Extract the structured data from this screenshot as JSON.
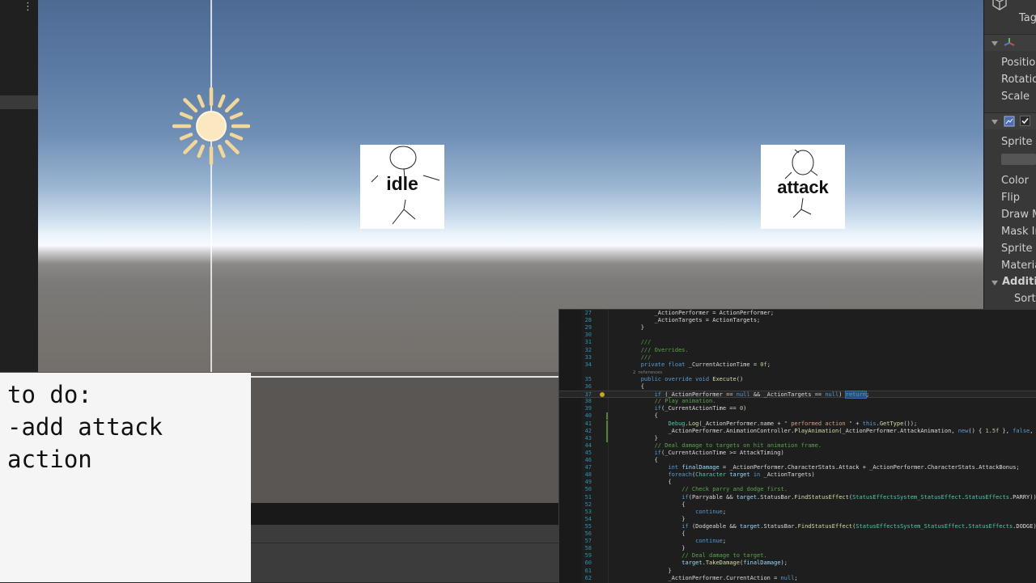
{
  "hierarchy": {
    "menu_icon": "kebab-menu-icon"
  },
  "scene": {
    "light_icon": "directional-light-sun-icon",
    "sprites": [
      {
        "label": "idle"
      },
      {
        "label": "attack"
      }
    ]
  },
  "inspector": {
    "header_icon": "cube-icon",
    "tag_label": "Tag",
    "transform": {
      "icon": "transform-axes-icon",
      "rows": [
        "Position",
        "Rotation",
        "Scale"
      ]
    },
    "sprite_renderer": {
      "icon": "sprite-renderer-icon",
      "enabled": true,
      "rows": [
        "Sprite",
        "Color",
        "Flip",
        "Draw M",
        "Mask In",
        "Sprite S",
        "Materia"
      ]
    },
    "additional": {
      "label": "Additio",
      "rows": [
        "Sorti"
      ]
    }
  },
  "todo_note": {
    "lines": [
      "to do:",
      "-add attack",
      "action"
    ]
  },
  "code_editor": {
    "lines": [
      {
        "num": "27",
        "code": "            _ActionPerformer = ActionPerformer;"
      },
      {
        "num": "28",
        "code": "            _ActionTargets = ActionTargets;"
      },
      {
        "num": "29",
        "code": "        }"
      },
      {
        "num": "30",
        "code": ""
      },
      {
        "num": "31",
        "code": "        ///"
      },
      {
        "num": "32",
        "code": "        /// Overrides."
      },
      {
        "num": "33",
        "code": "        ///"
      },
      {
        "num": "34",
        "code": "        private float _CurrentActionTime = 0f;"
      },
      {
        "num": "",
        "code": "        2 references"
      },
      {
        "num": "35",
        "code": "        public override void Execute()"
      },
      {
        "num": "36",
        "code": "        {"
      },
      {
        "num": "37",
        "code": "            if (_ActionPerformer == null && _ActionTargets == null) return;"
      },
      {
        "num": "38",
        "code": "            // Play animation."
      },
      {
        "num": "39",
        "code": "            if(_CurrentActionTime == 0)"
      },
      {
        "num": "40",
        "code": "            {"
      },
      {
        "num": "41",
        "code": "                Debug.Log(_ActionPerformer.name + \" performed action \" + this.GetType());"
      },
      {
        "num": "42",
        "code": "                _ActionPerformer.AnimationController.PlayAnimation(_ActionPerformer.AttackAnimation, new() { 1.5f }, false, 999);"
      },
      {
        "num": "43",
        "code": "            }"
      },
      {
        "num": "44",
        "code": "            // Deal damage to targets on hit animation frame."
      },
      {
        "num": "45",
        "code": "            if(_CurrentActionTime >= AttackTiming)"
      },
      {
        "num": "46",
        "code": "            {"
      },
      {
        "num": "47",
        "code": "                int finalDamage = _ActionPerformer.CharacterStats.Attack + _ActionPerformer.CharacterStats.AttackBonus;"
      },
      {
        "num": "48",
        "code": "                foreach(Character target in _ActionTargets)"
      },
      {
        "num": "49",
        "code": "                {"
      },
      {
        "num": "50",
        "code": "                    // Check parry and dodge first."
      },
      {
        "num": "51",
        "code": "                    if(Parryable && target.StatusBar.FindStatusEffect(StatusEffectsSystem_StatusEffect.StatusEffects.PARRY))"
      },
      {
        "num": "52",
        "code": "                    {"
      },
      {
        "num": "53",
        "code": "                        continue;"
      },
      {
        "num": "54",
        "code": "                    }"
      },
      {
        "num": "55",
        "code": "                    if (Dodgeable && target.StatusBar.FindStatusEffect(StatusEffectsSystem_StatusEffect.StatusEffects.DODGE))"
      },
      {
        "num": "56",
        "code": "                    {"
      },
      {
        "num": "57",
        "code": "                        continue;"
      },
      {
        "num": "58",
        "code": "                    }"
      },
      {
        "num": "59",
        "code": "                    // Deal damage to target."
      },
      {
        "num": "60",
        "code": "                    target.TakeDamage(finalDamage);"
      },
      {
        "num": "61",
        "code": "                }"
      },
      {
        "num": "62",
        "code": "                _ActionPerformer.CurrentAction = null;"
      }
    ]
  }
}
